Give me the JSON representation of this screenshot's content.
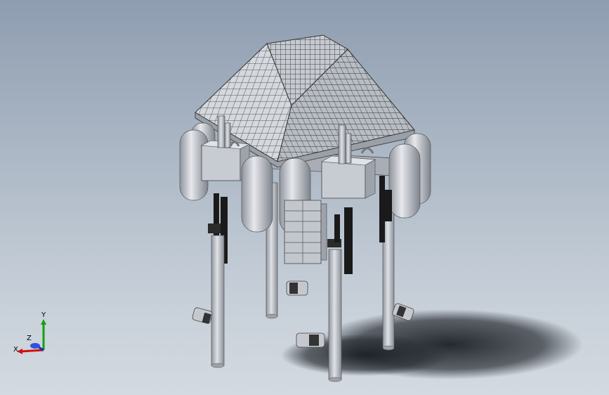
{
  "viewport": {
    "background_top": "#8e9db0",
    "background_bottom": "#d4dae1",
    "model_fill": "#c8ccd4",
    "model_dark": "#1a1a1a",
    "shadow": "#2a2e35"
  },
  "triad": {
    "x_label": "X",
    "y_label": "Y",
    "z_label": "Z",
    "x_color": "#d01010",
    "y_color": "#10a010",
    "z_color": "#1030c0"
  }
}
